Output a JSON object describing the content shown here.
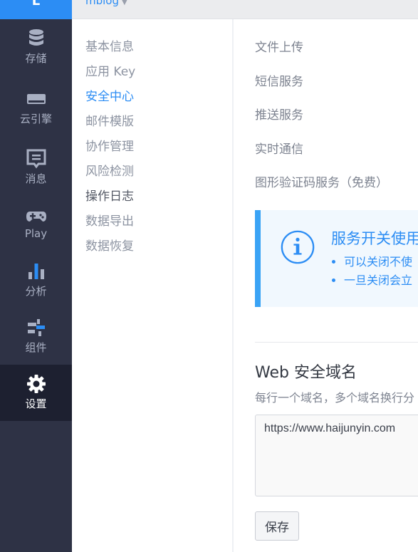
{
  "app": {
    "logo_letter": "L",
    "current_app": "mblog"
  },
  "leftnav": {
    "items": [
      {
        "label": "存储",
        "icon": "database-icon"
      },
      {
        "label": "云引擎",
        "icon": "server-icon"
      },
      {
        "label": "消息",
        "icon": "message-icon"
      },
      {
        "label": "Play",
        "icon": "gamepad-icon"
      },
      {
        "label": "分析",
        "icon": "bar-chart-icon"
      },
      {
        "label": "组件",
        "icon": "components-icon"
      },
      {
        "label": "设置",
        "icon": "gear-icon",
        "active": true
      }
    ]
  },
  "submenu": {
    "items": [
      {
        "label": "基本信息"
      },
      {
        "label": "应用 Key"
      },
      {
        "label": "安全中心",
        "active": true
      },
      {
        "label": "邮件模版"
      },
      {
        "label": "协作管理"
      },
      {
        "label": "风险检测"
      },
      {
        "label": "操作日志"
      },
      {
        "label": "数据导出"
      },
      {
        "label": "数据恢复"
      }
    ]
  },
  "main": {
    "services": [
      "文件上传",
      "短信服务",
      "推送服务",
      "实时通信",
      "图形验证码服务（免费）"
    ],
    "notice": {
      "title": "服务开关使用",
      "bullets": [
        "可以关闭不使",
        "一旦关闭会立"
      ]
    },
    "web_domain": {
      "title": "Web 安全域名",
      "description": "每行一个域名，多个域名换行分",
      "value": "https://www.haijunyin.com",
      "save_label": "保存"
    }
  },
  "colors": {
    "accent": "#2c8df4",
    "nav_bg": "#2e3245",
    "nav_active_bg": "#1d2030",
    "notice_bg": "#f1f8fe",
    "notice_border": "#3aa3f5"
  }
}
